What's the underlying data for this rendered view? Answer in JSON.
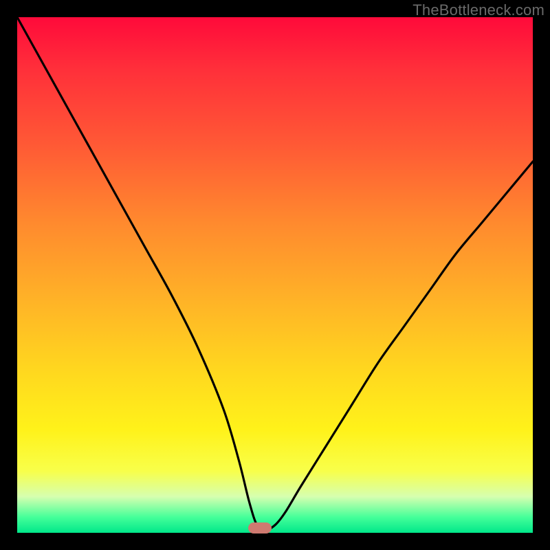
{
  "watermark": "TheBottleneck.com",
  "colors": {
    "gradient_top": "#ff0a3a",
    "gradient_bottom": "#00e78a",
    "curve": "#000000",
    "marker": "#cf7a70",
    "frame": "#000000"
  },
  "chart_data": {
    "type": "line",
    "title": "",
    "xlabel": "",
    "ylabel": "",
    "xlim": [
      0,
      100
    ],
    "ylim": [
      0,
      100
    ],
    "grid": false,
    "legend": false,
    "series": [
      {
        "name": "bottleneck-curve",
        "x": [
          0,
          5,
          10,
          15,
          20,
          25,
          30,
          35,
          40,
          43,
          45,
          46.5,
          48,
          50,
          52,
          55,
          60,
          65,
          70,
          75,
          80,
          85,
          90,
          95,
          100
        ],
        "y": [
          100,
          91,
          82,
          73,
          64,
          55,
          46,
          36,
          24,
          14,
          6,
          1.5,
          0.5,
          1.5,
          4,
          9,
          17,
          25,
          33,
          40,
          47,
          54,
          60,
          66,
          72
        ]
      }
    ],
    "annotations": [
      {
        "type": "marker",
        "shape": "rounded-rect",
        "x": 47,
        "y": 1,
        "color": "#cf7a70"
      }
    ]
  }
}
